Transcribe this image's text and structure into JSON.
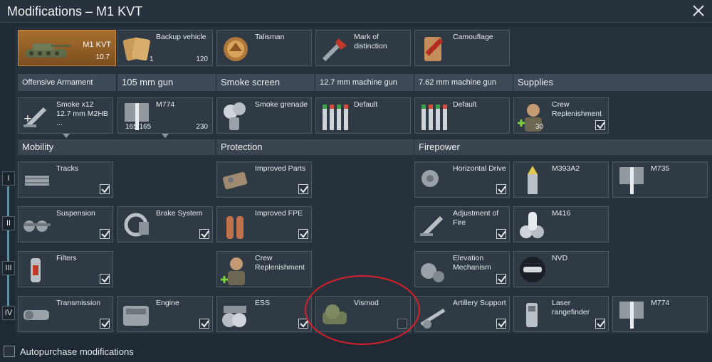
{
  "window": {
    "title": "Modifications – M1 KVT"
  },
  "top_row": [
    {
      "label": "M1 KVT",
      "sub": "10.7"
    },
    {
      "label": "Backup vehicle",
      "count_left": "1",
      "count_right": "120"
    },
    {
      "label": "Talisman"
    },
    {
      "label": "Mark of distinction"
    },
    {
      "label": "Camouflage"
    }
  ],
  "categories": [
    "Offensive Armament",
    "105 mm gun",
    "Smoke screen",
    "12.7 mm machine gun",
    "7.62 mm machine gun",
    "Supplies"
  ],
  "weapons": [
    {
      "label": "Smoke x12 12.7 mm M2HB ..."
    },
    {
      "label": "M774",
      "count_left": "165/165",
      "count_right": "230"
    },
    {
      "label": "Smoke grenade"
    },
    {
      "label": "Default"
    },
    {
      "label": "Default"
    },
    {
      "label": "Crew Replenishment",
      "count_left": "30"
    }
  ],
  "sections": {
    "mobility": "Mobility",
    "protection": "Protection",
    "firepower": "Firepower"
  },
  "tiers": [
    "I",
    "II",
    "III",
    "IV"
  ],
  "mods": {
    "tracks": "Tracks",
    "suspension": "Suspension",
    "brake": "Brake System",
    "filters": "Filters",
    "transmission": "Transmission",
    "engine": "Engine",
    "improved_parts": "Improved Parts",
    "improved_fpe": "Improved FPE",
    "crew_repl": "Crew Replenishment",
    "ess": "ESS",
    "vismod": "Vismod",
    "horizontal_drive": "Horizontal Drive",
    "m393a2": "M393A2",
    "m735": "M735",
    "adj_fire": "Adjustment of Fire",
    "m416": "M416",
    "elevation": "Elevation Mechanism",
    "nvd": "NVD",
    "artillery": "Artillery Support",
    "laser": "Laser rangefinder",
    "m774": "M774"
  },
  "autopurchase": {
    "label": "Autopurchase modifications"
  },
  "colors": {
    "accent": "#c48a45",
    "annotation": "#d8202a"
  }
}
